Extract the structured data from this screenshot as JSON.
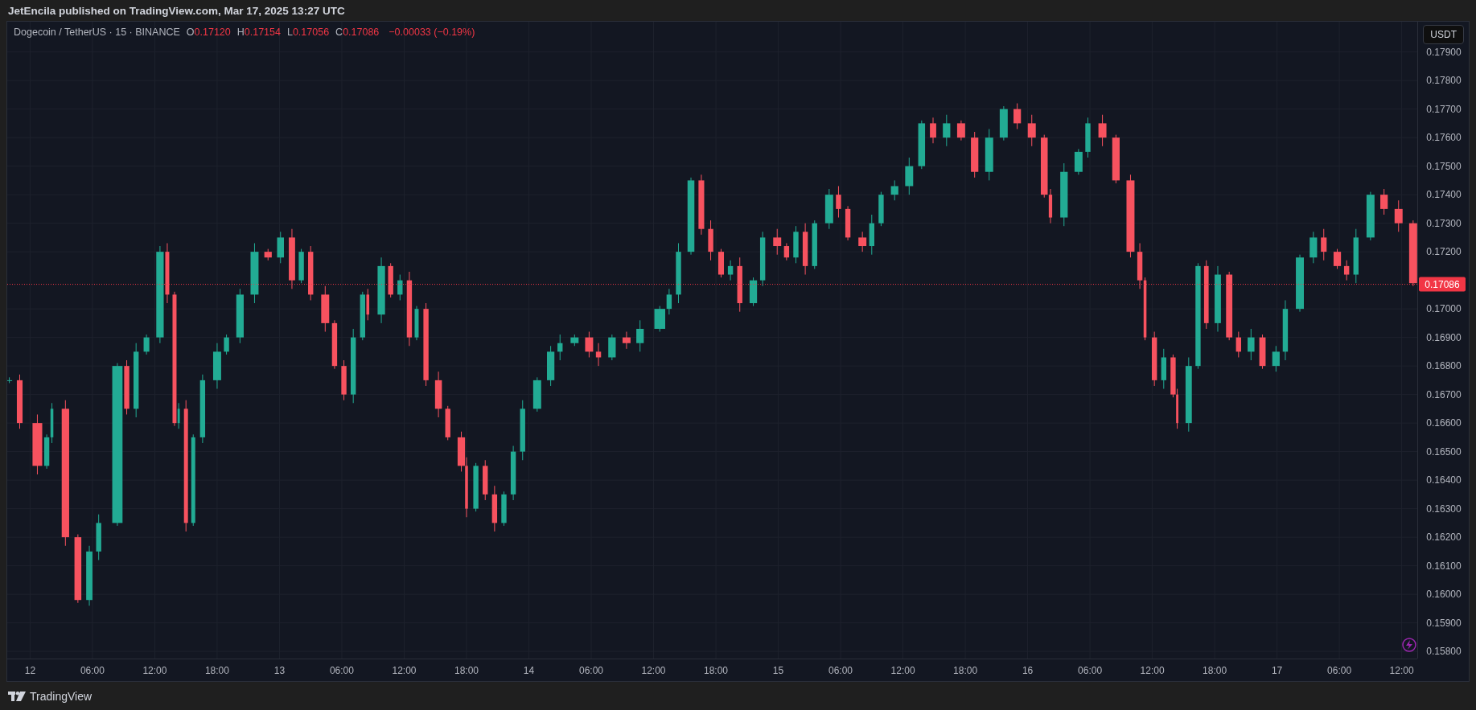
{
  "header": {
    "text": "JetEncila published on TradingView.com, Mar 17, 2025 13:27 UTC"
  },
  "legend": {
    "symbol": "Dogecoin / TetherUS · 15 · BINANCE",
    "ohlc": [
      {
        "label": "O",
        "value": "0.17120"
      },
      {
        "label": "H",
        "value": "0.17154"
      },
      {
        "label": "L",
        "value": "0.17056"
      },
      {
        "label": "C",
        "value": "0.17086"
      }
    ],
    "change": "−0.00033 (−0.19%)"
  },
  "currency_button": "USDT",
  "chart": {
    "chart_data": {
      "type": "candlestick",
      "grid": true,
      "xlim": [
        "2025-03-11 21:48",
        "2025-03-17 13:30"
      ],
      "ylim": [
        0.15775,
        0.18006
      ],
      "x": [
        "2025-03-11 22:00",
        "2025-03-11 23:00",
        "2025-03-12 00:42",
        "2025-03-12 01:36",
        "2025-03-12 02:06",
        "2025-03-12 03:24",
        "2025-03-12 04:36",
        "2025-03-12 05:42",
        "2025-03-12 06:36",
        "2025-03-12 08:24",
        "2025-03-12 09:18",
        "2025-03-12 10:12",
        "2025-03-12 11:12",
        "2025-03-12 12:30",
        "2025-03-12 13:12",
        "2025-03-12 13:54",
        "2025-03-12 14:18",
        "2025-03-12 15:00",
        "2025-03-12 15:42",
        "2025-03-12 16:36",
        "2025-03-12 18:00",
        "2025-03-12 18:54",
        "2025-03-12 20:12",
        "2025-03-12 21:36",
        "2025-03-12 22:54",
        "2025-03-13 00:06",
        "2025-03-13 01:12",
        "2025-03-13 02:06",
        "2025-03-13 03:00",
        "2025-03-13 04:24",
        "2025-03-13 05:18",
        "2025-03-13 06:12",
        "2025-03-13 07:06",
        "2025-03-13 08:00",
        "2025-03-13 08:30",
        "2025-03-13 09:48",
        "2025-03-13 10:42",
        "2025-03-13 11:36",
        "2025-03-13 12:30",
        "2025-03-13 13:12",
        "2025-03-13 14:06",
        "2025-03-13 15:18",
        "2025-03-13 16:12",
        "2025-03-13 17:30",
        "2025-03-13 18:00",
        "2025-03-13 18:54",
        "2025-03-13 19:48",
        "2025-03-13 20:42",
        "2025-03-13 21:36",
        "2025-03-13 22:30",
        "2025-03-13 23:24",
        "2025-03-14 00:48",
        "2025-03-14 02:06",
        "2025-03-14 03:00",
        "2025-03-14 04:24",
        "2025-03-14 05:48",
        "2025-03-14 06:42",
        "2025-03-14 08:00",
        "2025-03-14 09:24",
        "2025-03-14 10:42",
        "2025-03-14 12:36",
        "2025-03-14 13:30",
        "2025-03-14 14:24",
        "2025-03-14 15:36",
        "2025-03-14 16:36",
        "2025-03-14 17:30",
        "2025-03-14 18:30",
        "2025-03-14 19:24",
        "2025-03-14 20:18",
        "2025-03-14 21:36",
        "2025-03-14 22:30",
        "2025-03-14 23:54",
        "2025-03-15 00:48",
        "2025-03-15 01:42",
        "2025-03-15 02:36",
        "2025-03-15 03:30",
        "2025-03-15 04:54",
        "2025-03-15 05:48",
        "2025-03-15 06:42",
        "2025-03-15 08:06",
        "2025-03-15 09:00",
        "2025-03-15 09:54",
        "2025-03-15 11:12",
        "2025-03-15 12:36",
        "2025-03-15 13:48",
        "2025-03-15 14:54",
        "2025-03-15 16:12",
        "2025-03-15 17:36",
        "2025-03-15 18:54",
        "2025-03-15 20:18",
        "2025-03-15 21:42",
        "2025-03-15 23:00",
        "2025-03-16 00:24",
        "2025-03-16 01:36",
        "2025-03-16 02:12",
        "2025-03-16 03:30",
        "2025-03-16 04:54",
        "2025-03-16 05:48",
        "2025-03-16 07:12",
        "2025-03-16 08:30",
        "2025-03-16 09:54",
        "2025-03-16 10:48",
        "2025-03-16 11:18",
        "2025-03-16 12:12",
        "2025-03-16 13:06",
        "2025-03-16 14:00",
        "2025-03-16 14:24",
        "2025-03-16 15:30",
        "2025-03-16 16:24",
        "2025-03-16 17:12",
        "2025-03-16 18:18",
        "2025-03-16 19:24",
        "2025-03-16 20:18",
        "2025-03-16 21:30",
        "2025-03-16 22:36",
        "2025-03-16 23:54",
        "2025-03-17 00:48",
        "2025-03-17 02:12",
        "2025-03-17 03:30",
        "2025-03-17 04:30",
        "2025-03-17 05:48",
        "2025-03-17 06:42",
        "2025-03-17 07:36",
        "2025-03-17 09:00",
        "2025-03-17 10:18",
        "2025-03-17 11:42",
        "2025-03-17 13:06"
      ],
      "ohlc": [
        [
          0.1675,
          0.1676,
          0.1674,
          0.1675
        ],
        [
          0.1675,
          0.1677,
          0.1658,
          0.166
        ],
        [
          0.166,
          0.1663,
          0.1642,
          0.1645
        ],
        [
          0.1645,
          0.1656,
          0.1644,
          0.1655
        ],
        [
          0.1655,
          0.1667,
          0.1653,
          0.1665
        ],
        [
          0.1665,
          0.1668,
          0.1617,
          0.162
        ],
        [
          0.162,
          0.1621,
          0.1597,
          0.1598
        ],
        [
          0.1598,
          0.1617,
          0.1596,
          0.1615
        ],
        [
          0.1615,
          0.1628,
          0.1612,
          0.1625
        ],
        [
          0.1625,
          0.1681,
          0.1624,
          0.168
        ],
        [
          0.168,
          0.1682,
          0.1663,
          0.1665
        ],
        [
          0.1665,
          0.1688,
          0.1662,
          0.1685
        ],
        [
          0.1685,
          0.1691,
          0.1684,
          0.169
        ],
        [
          0.169,
          0.1722,
          0.1688,
          0.172
        ],
        [
          0.172,
          0.1723,
          0.1702,
          0.1705
        ],
        [
          0.1705,
          0.1706,
          0.1659,
          0.166
        ],
        [
          0.166,
          0.1667,
          0.1658,
          0.1665
        ],
        [
          0.1665,
          0.1668,
          0.1622,
          0.1625
        ],
        [
          0.1625,
          0.1656,
          0.1624,
          0.1655
        ],
        [
          0.1655,
          0.1677,
          0.1653,
          0.1675
        ],
        [
          0.1675,
          0.1688,
          0.1672,
          0.1685
        ],
        [
          0.1685,
          0.1691,
          0.1684,
          0.169
        ],
        [
          0.169,
          0.1707,
          0.1688,
          0.1705
        ],
        [
          0.1705,
          0.1723,
          0.1702,
          0.172
        ],
        [
          0.172,
          0.1721,
          0.1717,
          0.1718
        ],
        [
          0.1718,
          0.1727,
          0.1716,
          0.1725
        ],
        [
          0.1725,
          0.1728,
          0.1707,
          0.171
        ],
        [
          0.171,
          0.1721,
          0.1709,
          0.172
        ],
        [
          0.172,
          0.1722,
          0.1703,
          0.1705
        ],
        [
          0.1705,
          0.1708,
          0.1692,
          0.1695
        ],
        [
          0.1695,
          0.1696,
          0.1679,
          0.168
        ],
        [
          0.168,
          0.1682,
          0.1668,
          0.167
        ],
        [
          0.167,
          0.1693,
          0.1667,
          0.169
        ],
        [
          0.169,
          0.1706,
          0.1689,
          0.1705
        ],
        [
          0.1705,
          0.1707,
          0.1696,
          0.1698
        ],
        [
          0.1698,
          0.1718,
          0.1695,
          0.1715
        ],
        [
          0.1715,
          0.1716,
          0.1704,
          0.1705
        ],
        [
          0.1705,
          0.1712,
          0.1703,
          0.171
        ],
        [
          0.171,
          0.1713,
          0.1687,
          0.169
        ],
        [
          0.169,
          0.1701,
          0.1689,
          0.17
        ],
        [
          0.17,
          0.1702,
          0.1673,
          0.1675
        ],
        [
          0.1675,
          0.1678,
          0.1662,
          0.1665
        ],
        [
          0.1665,
          0.1666,
          0.1654,
          0.1655
        ],
        [
          0.1655,
          0.1657,
          0.1643,
          0.1645
        ],
        [
          0.1645,
          0.1648,
          0.1627,
          0.163
        ],
        [
          0.163,
          0.1646,
          0.1629,
          0.1645
        ],
        [
          0.1645,
          0.1647,
          0.1633,
          0.1635
        ],
        [
          0.1635,
          0.1638,
          0.1622,
          0.1625
        ],
        [
          0.1625,
          0.1636,
          0.1624,
          0.1635
        ],
        [
          0.1635,
          0.1652,
          0.1633,
          0.165
        ],
        [
          0.165,
          0.1668,
          0.1647,
          0.1665
        ],
        [
          0.1665,
          0.1676,
          0.1664,
          0.1675
        ],
        [
          0.1675,
          0.1687,
          0.1673,
          0.1685
        ],
        [
          0.1685,
          0.1691,
          0.1682,
          0.1688
        ],
        [
          0.1688,
          0.1691,
          0.1687,
          0.169
        ],
        [
          0.169,
          0.1692,
          0.1683,
          0.1685
        ],
        [
          0.1685,
          0.1688,
          0.168,
          0.1683
        ],
        [
          0.1683,
          0.1691,
          0.1682,
          0.169
        ],
        [
          0.169,
          0.1692,
          0.1686,
          0.1688
        ],
        [
          0.1688,
          0.1696,
          0.1685,
          0.1693
        ],
        [
          0.1693,
          0.1701,
          0.1692,
          0.17
        ],
        [
          0.17,
          0.1707,
          0.1698,
          0.1705
        ],
        [
          0.1705,
          0.1723,
          0.1702,
          0.172
        ],
        [
          0.172,
          0.1746,
          0.1719,
          0.1745
        ],
        [
          0.1745,
          0.1747,
          0.1726,
          0.1728
        ],
        [
          0.1728,
          0.1731,
          0.1717,
          0.172
        ],
        [
          0.172,
          0.1721,
          0.1711,
          0.1712
        ],
        [
          0.1712,
          0.1717,
          0.171,
          0.1715
        ],
        [
          0.1715,
          0.1718,
          0.1699,
          0.1702
        ],
        [
          0.1702,
          0.1711,
          0.1701,
          0.171
        ],
        [
          0.171,
          0.1727,
          0.1708,
          0.1725
        ],
        [
          0.1725,
          0.1728,
          0.1719,
          0.1722
        ],
        [
          0.1722,
          0.1723,
          0.1717,
          0.1718
        ],
        [
          0.1718,
          0.1729,
          0.1716,
          0.1727
        ],
        [
          0.1727,
          0.173,
          0.1712,
          0.1715
        ],
        [
          0.1715,
          0.1731,
          0.1714,
          0.173
        ],
        [
          0.173,
          0.1742,
          0.1728,
          0.174
        ],
        [
          0.174,
          0.1743,
          0.1732,
          0.1735
        ],
        [
          0.1735,
          0.1736,
          0.1724,
          0.1725
        ],
        [
          0.1725,
          0.1727,
          0.172,
          0.1722
        ],
        [
          0.1722,
          0.1733,
          0.1719,
          0.173
        ],
        [
          0.173,
          0.1741,
          0.1729,
          0.174
        ],
        [
          0.174,
          0.1745,
          0.1738,
          0.1743
        ],
        [
          0.1743,
          0.1753,
          0.174,
          0.175
        ],
        [
          0.175,
          0.1766,
          0.1749,
          0.1765
        ],
        [
          0.1765,
          0.1767,
          0.1758,
          0.176
        ],
        [
          0.176,
          0.1768,
          0.1757,
          0.1765
        ],
        [
          0.1765,
          0.1766,
          0.1759,
          0.176
        ],
        [
          0.176,
          0.1762,
          0.1746,
          0.1748
        ],
        [
          0.1748,
          0.1763,
          0.1745,
          0.176
        ],
        [
          0.176,
          0.1771,
          0.1759,
          0.177
        ],
        [
          0.177,
          0.1772,
          0.1763,
          0.1765
        ],
        [
          0.1765,
          0.1768,
          0.1757,
          0.176
        ],
        [
          0.176,
          0.1761,
          0.1739,
          0.174
        ],
        [
          0.174,
          0.1742,
          0.173,
          0.1732
        ],
        [
          0.1732,
          0.1751,
          0.1729,
          0.1748
        ],
        [
          0.1748,
          0.1756,
          0.1747,
          0.1755
        ],
        [
          0.1755,
          0.1767,
          0.1753,
          0.1765
        ],
        [
          0.1765,
          0.1768,
          0.1757,
          0.176
        ],
        [
          0.176,
          0.1761,
          0.1744,
          0.1745
        ],
        [
          0.1745,
          0.1747,
          0.1718,
          0.172
        ],
        [
          0.172,
          0.1723,
          0.1707,
          0.171
        ],
        [
          0.171,
          0.1711,
          0.1689,
          0.169
        ],
        [
          0.169,
          0.1692,
          0.1673,
          0.1675
        ],
        [
          0.1675,
          0.1686,
          0.1672,
          0.1683
        ],
        [
          0.1683,
          0.1684,
          0.1669,
          0.167
        ],
        [
          0.167,
          0.1672,
          0.1658,
          0.166
        ],
        [
          0.166,
          0.1683,
          0.1657,
          0.168
        ],
        [
          0.168,
          0.1716,
          0.1679,
          0.1715
        ],
        [
          0.1715,
          0.1717,
          0.1693,
          0.1695
        ],
        [
          0.1695,
          0.1715,
          0.1692,
          0.1712
        ],
        [
          0.1712,
          0.1713,
          0.1689,
          0.169
        ],
        [
          0.169,
          0.1692,
          0.1683,
          0.1685
        ],
        [
          0.1685,
          0.1693,
          0.1682,
          0.169
        ],
        [
          0.169,
          0.1691,
          0.1679,
          0.168
        ],
        [
          0.168,
          0.1687,
          0.1678,
          0.1685
        ],
        [
          0.1685,
          0.1703,
          0.1682,
          0.17
        ],
        [
          0.17,
          0.1719,
          0.1699,
          0.1718
        ],
        [
          0.1718,
          0.1727,
          0.1716,
          0.1725
        ],
        [
          0.1725,
          0.1728,
          0.1717,
          0.172
        ],
        [
          0.172,
          0.1721,
          0.1714,
          0.1715
        ],
        [
          0.1715,
          0.1717,
          0.171,
          0.1712
        ],
        [
          0.1712,
          0.1728,
          0.1709,
          0.1725
        ],
        [
          0.1725,
          0.1741,
          0.1724,
          0.174
        ],
        [
          0.174,
          0.1742,
          0.1733,
          0.1735
        ],
        [
          0.1735,
          0.1738,
          0.1727,
          0.173
        ],
        [
          0.173,
          0.1731,
          0.1708,
          0.1709
        ]
      ],
      "yticks": [
        {
          "value": 0.158,
          "label": "0.15800"
        },
        {
          "value": 0.159,
          "label": "0.15900"
        },
        {
          "value": 0.16,
          "label": "0.16000"
        },
        {
          "value": 0.161,
          "label": "0.16100"
        },
        {
          "value": 0.162,
          "label": "0.16200"
        },
        {
          "value": 0.163,
          "label": "0.16300"
        },
        {
          "value": 0.164,
          "label": "0.16400"
        },
        {
          "value": 0.165,
          "label": "0.16500"
        },
        {
          "value": 0.166,
          "label": "0.16600"
        },
        {
          "value": 0.167,
          "label": "0.16700"
        },
        {
          "value": 0.168,
          "label": "0.16800"
        },
        {
          "value": 0.169,
          "label": "0.16900"
        },
        {
          "value": 0.17,
          "label": "0.17000"
        },
        {
          "value": 0.172,
          "label": "0.17200"
        },
        {
          "value": 0.173,
          "label": "0.17300"
        },
        {
          "value": 0.174,
          "label": "0.17400"
        },
        {
          "value": 0.175,
          "label": "0.17500"
        },
        {
          "value": 0.176,
          "label": "0.17600"
        },
        {
          "value": 0.177,
          "label": "0.17700"
        },
        {
          "value": 0.178,
          "label": "0.17800"
        },
        {
          "value": 0.179,
          "label": "0.17900"
        }
      ],
      "xticks": [
        {
          "value": "2025-03-12 00:00",
          "label": "12"
        },
        {
          "value": "2025-03-12 06:00",
          "label": "06:00"
        },
        {
          "value": "2025-03-12 12:00",
          "label": "12:00"
        },
        {
          "value": "2025-03-12 18:00",
          "label": "18:00"
        },
        {
          "value": "2025-03-13 00:00",
          "label": "13"
        },
        {
          "value": "2025-03-13 06:00",
          "label": "06:00"
        },
        {
          "value": "2025-03-13 12:00",
          "label": "12:00"
        },
        {
          "value": "2025-03-13 18:00",
          "label": "18:00"
        },
        {
          "value": "2025-03-14 00:00",
          "label": "14"
        },
        {
          "value": "2025-03-14 06:00",
          "label": "06:00"
        },
        {
          "value": "2025-03-14 12:00",
          "label": "12:00"
        },
        {
          "value": "2025-03-14 18:00",
          "label": "18:00"
        },
        {
          "value": "2025-03-15 00:00",
          "label": "15"
        },
        {
          "value": "2025-03-15 06:00",
          "label": "06:00"
        },
        {
          "value": "2025-03-15 12:00",
          "label": "12:00"
        },
        {
          "value": "2025-03-15 18:00",
          "label": "18:00"
        },
        {
          "value": "2025-03-16 00:00",
          "label": "16"
        },
        {
          "value": "2025-03-16 06:00",
          "label": "06:00"
        },
        {
          "value": "2025-03-16 12:00",
          "label": "12:00"
        },
        {
          "value": "2025-03-16 18:00",
          "label": "18:00"
        },
        {
          "value": "2025-03-17 00:00",
          "label": "17"
        },
        {
          "value": "2025-03-17 06:00",
          "label": "06:00"
        },
        {
          "value": "2025-03-17 12:00",
          "label": "12:00"
        }
      ],
      "ref_lines": [
        {
          "axis": "y",
          "value": 0.17086,
          "label": "0.17086",
          "color": "#f23645"
        }
      ]
    }
  },
  "footer": {
    "brand": "TradingView"
  }
}
